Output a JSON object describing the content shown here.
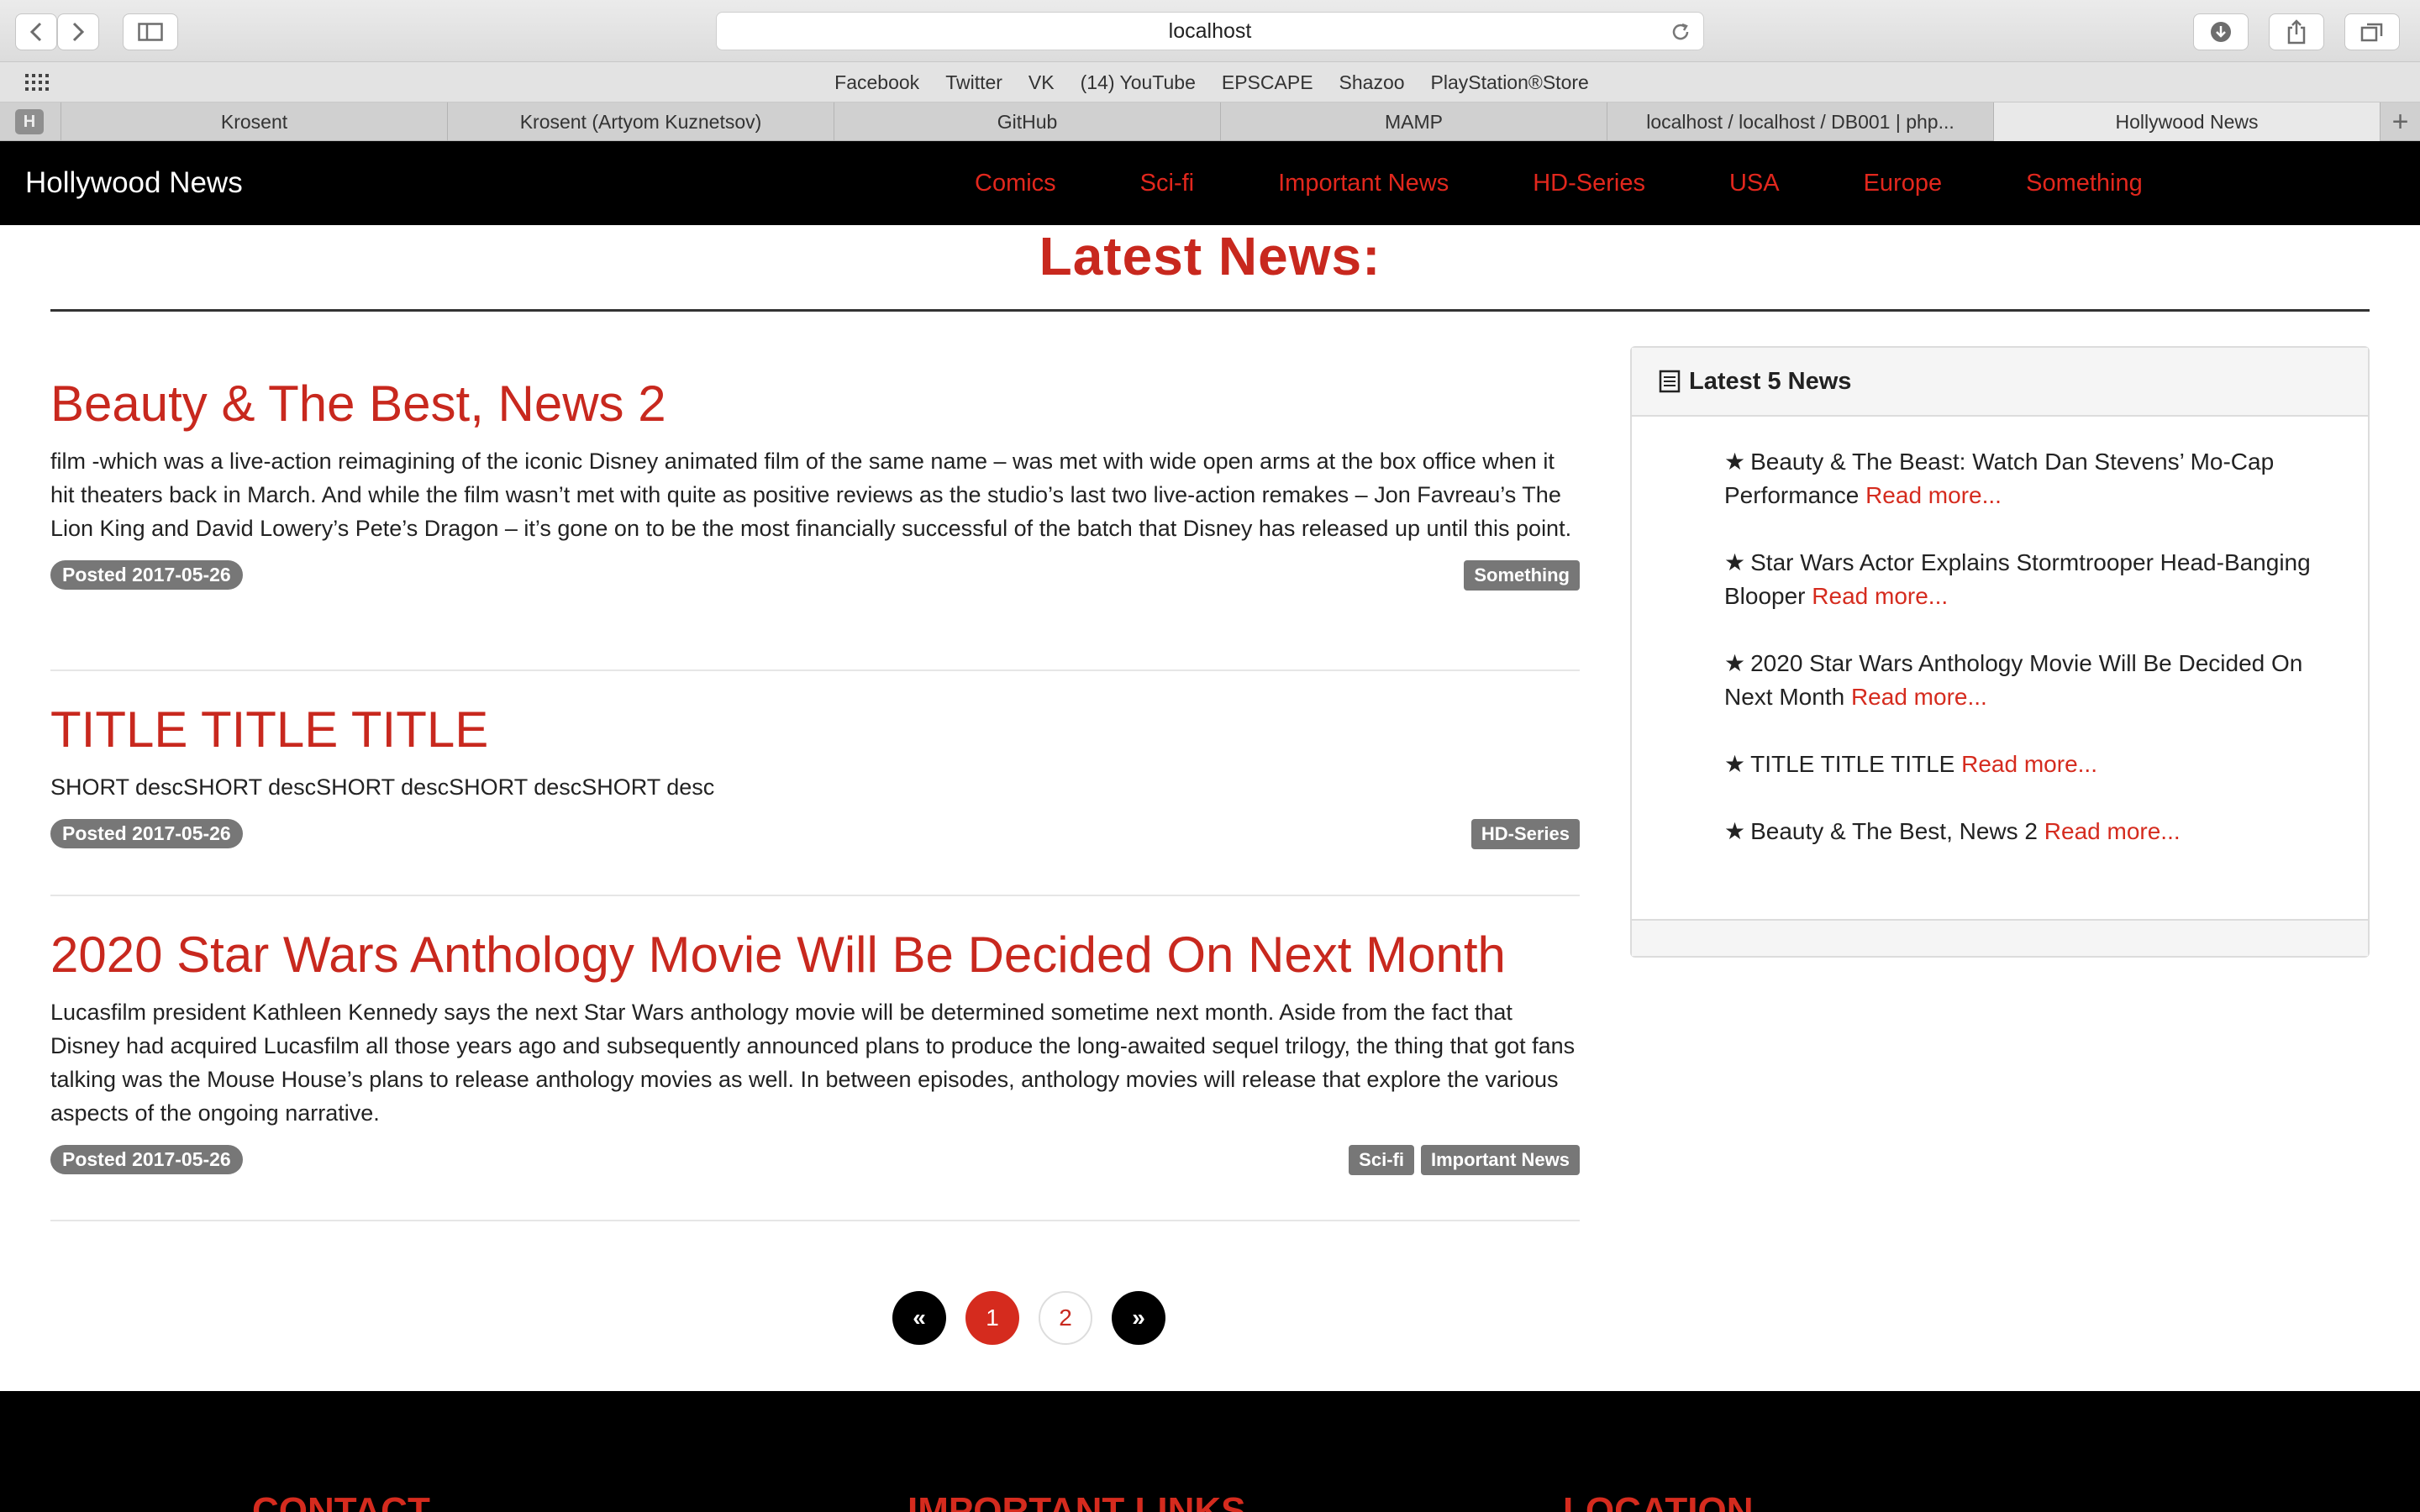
{
  "browser": {
    "address": "localhost",
    "favorites": [
      "Facebook",
      "Twitter",
      "VK",
      "(14) YouTube",
      "EPSCAPE",
      "Shazoo",
      "PlayStation®Store"
    ],
    "tab_pin_label": "H",
    "tabs": [
      "Krosent",
      "Krosent (Artyom Kuznetsov)",
      "GitHub",
      "MAMP",
      "localhost / localhost / DB001 | php...",
      "Hollywood News"
    ],
    "new_tab": "+"
  },
  "site": {
    "brand": "Hollywood News",
    "nav": [
      "Comics",
      "Sci-fi",
      "Important News",
      "HD-Series",
      "USA",
      "Europe",
      "Something"
    ]
  },
  "main": {
    "heading": "Latest News:",
    "posts": [
      {
        "title": "Beauty & The Best, News 2",
        "body": "film -which was a live-action reimagining of the iconic Disney animated film of the same name – was met with wide open arms at the box office when it hit theaters back in March. And while the film wasn’t met with quite as positive reviews as the studio’s last two live-action remakes – Jon Favreau’s The Lion King and David Lowery’s Pete’s Dragon – it’s gone on to be the most financially successful of the batch that Disney has released up until this point.",
        "date": "Posted 2017-05-26",
        "tags": [
          "Something"
        ]
      },
      {
        "title": "TITLE TITLE TITLE",
        "body": "SHORT descSHORT descSHORT descSHORT descSHORT desc",
        "date": "Posted 2017-05-26",
        "tags": [
          "HD-Series"
        ]
      },
      {
        "title": "2020 Star Wars Anthology Movie Will Be Decided On Next Month",
        "body": "Lucasfilm president Kathleen Kennedy says the next Star Wars anthology movie will be determined sometime next month. Aside from the fact that Disney had acquired Lucasfilm all those years ago and subsequently announced plans to produce the long-awaited sequel trilogy, the thing that got fans talking was the Mouse House’s plans to release anthology movies as well. In between episodes, anthology movies will release that explore the various aspects of the ongoing narrative.",
        "date": "Posted 2017-05-26",
        "tags": [
          "Sci-fi",
          "Important News"
        ]
      }
    ],
    "pagination": {
      "prev": "«",
      "pages": [
        "1",
        "2"
      ],
      "current": "1",
      "next": "»"
    }
  },
  "sidebar": {
    "title": "Latest 5 News",
    "read_more": "Read more...",
    "star": "★",
    "items": [
      "Beauty & The Beast: Watch Dan Stevens’ Mo-Cap Performance",
      "Star Wars Actor Explains Stormtrooper Head-Banging Blooper",
      "2020 Star Wars Anthology Movie Will Be Decided On Next Month",
      "TITLE TITLE TITLE",
      "Beauty & The Best, News 2"
    ]
  },
  "footer": {
    "headings": [
      "CONTACT",
      "IMPORTANT LINKS",
      "LOCATION"
    ]
  },
  "colors": {
    "accent": "#d52b1e",
    "nav_bg": "#000000",
    "badge": "#777777"
  }
}
